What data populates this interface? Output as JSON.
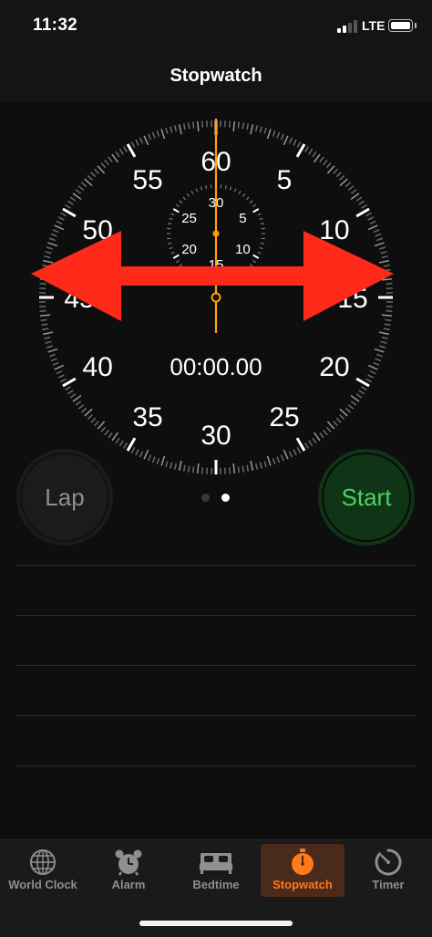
{
  "status_bar": {
    "time": "11:32",
    "network": "LTE",
    "signal_bars": 2,
    "signal_total": 4
  },
  "nav": {
    "title": "Stopwatch"
  },
  "dial": {
    "major_labels": [
      "60",
      "5",
      "10",
      "15",
      "20",
      "25",
      "30",
      "35",
      "40",
      "45",
      "50",
      "55"
    ],
    "minor_labels": [
      "30",
      "5",
      "10",
      "15",
      "20",
      "25"
    ],
    "readout": "00:00.00",
    "hand_color": "#ff9f0a"
  },
  "buttons": {
    "lap_label": "Lap",
    "start_label": "Start"
  },
  "pager": {
    "count": 2,
    "active_index": 1
  },
  "laps": [],
  "tabs": [
    {
      "label": "World Clock",
      "icon": "globe-icon",
      "active": false
    },
    {
      "label": "Alarm",
      "icon": "alarm-clock-icon",
      "active": false
    },
    {
      "label": "Bedtime",
      "icon": "bed-icon",
      "active": false
    },
    {
      "label": "Stopwatch",
      "icon": "stopwatch-icon",
      "active": true
    },
    {
      "label": "Timer",
      "icon": "timer-icon",
      "active": false
    }
  ],
  "colors": {
    "accent": "#ff9f0a",
    "start_text": "#4ed164",
    "start_bg": "#0f3416",
    "tab_active": "#ff7a1a",
    "overlay_arrow": "#ff2a1a"
  }
}
